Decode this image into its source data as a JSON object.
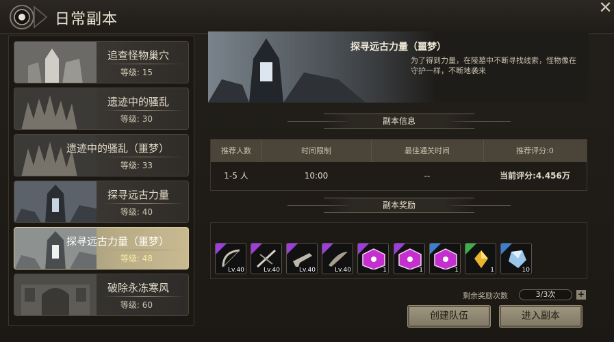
{
  "window": {
    "title": "日常副本"
  },
  "dungeons": [
    {
      "name": "追查怪物巢穴",
      "level": "等级: 15"
    },
    {
      "name": "遗迹中的骚乱",
      "level": "等级: 30"
    },
    {
      "name": "遗迹中的骚乱（噩梦）",
      "level": "等级: 33"
    },
    {
      "name": "探寻远古力量",
      "level": "等级: 40"
    },
    {
      "name": "探寻远古力量（噩梦）",
      "level": "等级: 48"
    },
    {
      "name": "破除永冻寒风",
      "level": "等级: 60"
    }
  ],
  "selected_index": 4,
  "banner": {
    "title": "探寻远古力量（噩梦）",
    "description": "为了得到力量，在陵墓中不断寻找线索，怪物像在守护一样，不断地袭来"
  },
  "info": {
    "header": "副本信息",
    "columns": [
      "推荐人数",
      "时间限制",
      "最佳通关时间",
      "推荐评分:0"
    ],
    "values": [
      "1-5 人",
      "10:00",
      "--",
      "当前评分:4.456万"
    ]
  },
  "rewards": {
    "header": "副本奖励",
    "items": [
      {
        "icon": "bow-icon",
        "qty": "Lv.40",
        "rarity": "purple"
      },
      {
        "icon": "crossbow-icon",
        "qty": "Lv.40",
        "rarity": "purple"
      },
      {
        "icon": "gun-icon",
        "qty": "Lv.40",
        "rarity": "purple"
      },
      {
        "icon": "blade-icon",
        "qty": "Lv.40",
        "rarity": "purple"
      },
      {
        "icon": "magenta-box-icon",
        "qty": "1",
        "rarity": "purple"
      },
      {
        "icon": "magenta-box-icon",
        "qty": "1",
        "rarity": "purple"
      },
      {
        "icon": "magenta-box-icon",
        "qty": "1",
        "rarity": "blue"
      },
      {
        "icon": "gold-crystal-icon",
        "qty": "1",
        "rarity": "green"
      },
      {
        "icon": "blue-crystal-icon",
        "qty": "10",
        "rarity": "blue"
      }
    ],
    "colors": {
      "purple": "#9b3fd8",
      "blue": "#3a7fd0",
      "green": "#3fae4a"
    }
  },
  "remaining": {
    "label": "剩余奖励次数",
    "value": "3/3次"
  },
  "buttons": {
    "create_team": "创建队伍",
    "enter": "进入副本"
  }
}
